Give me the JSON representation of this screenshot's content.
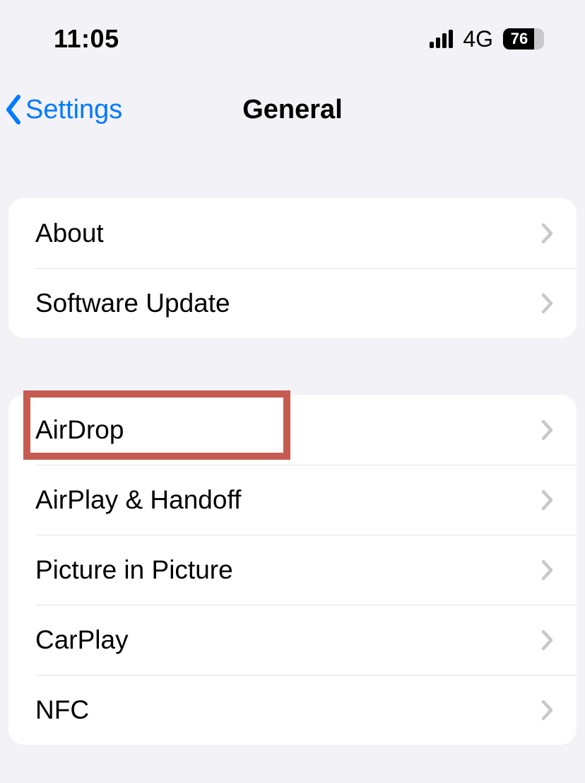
{
  "status": {
    "time": "11:05",
    "network_type": "4G",
    "battery_percent": "76"
  },
  "nav": {
    "back_label": "Settings",
    "title": "General"
  },
  "groups": [
    {
      "rows": [
        {
          "label": "About"
        },
        {
          "label": "Software Update"
        }
      ]
    },
    {
      "rows": [
        {
          "label": "AirDrop"
        },
        {
          "label": "AirPlay & Handoff"
        },
        {
          "label": "Picture in Picture"
        },
        {
          "label": "CarPlay"
        },
        {
          "label": "NFC"
        }
      ]
    }
  ],
  "highlight": {
    "target_label": "AirDrop"
  }
}
